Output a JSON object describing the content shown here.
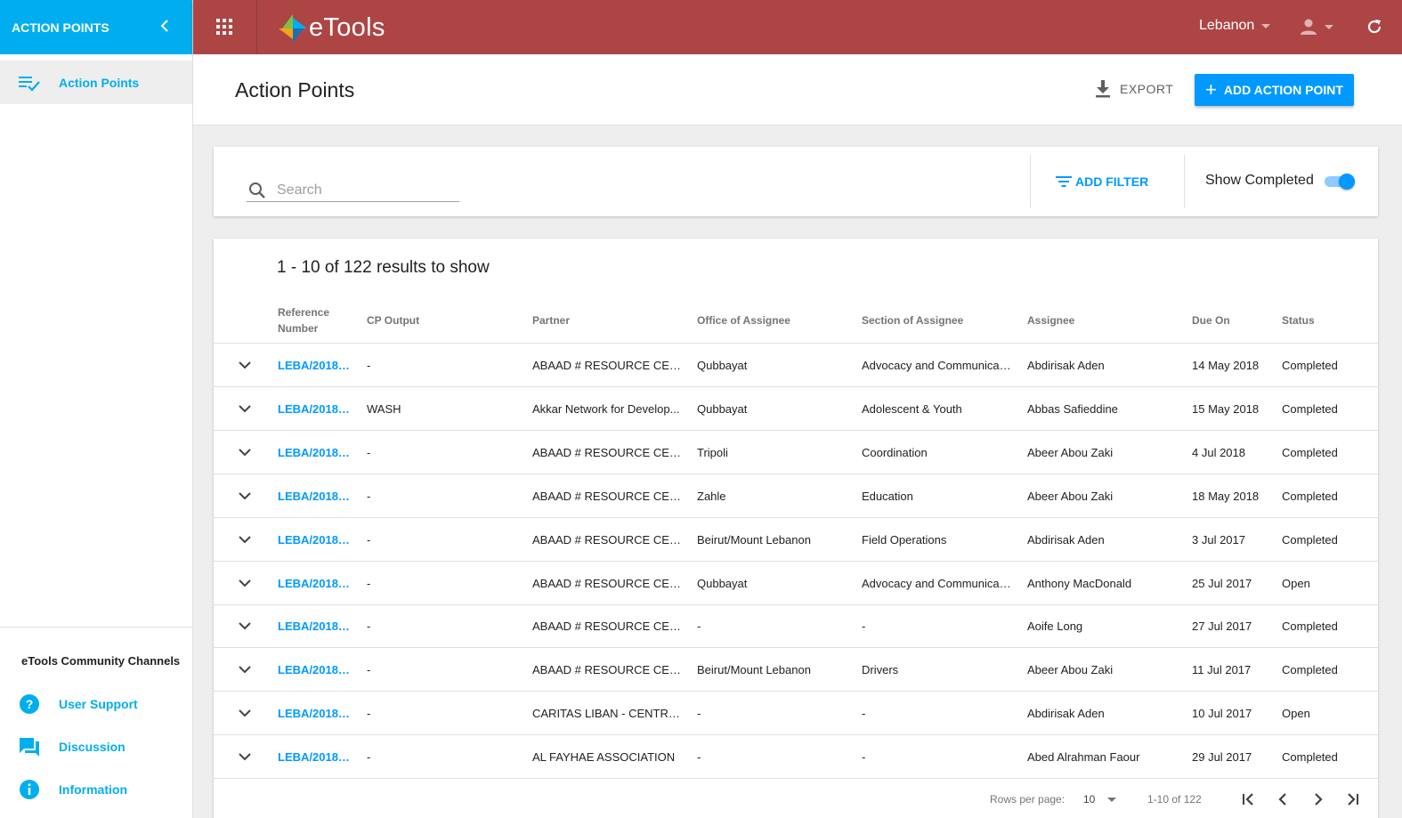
{
  "sidebar": {
    "header_title": "ACTION POINTS",
    "collapse_icon": "chevron-left-icon",
    "nav": [
      {
        "label": "Action Points",
        "icon": "checklist-icon"
      }
    ],
    "channels_title": "eTools Community Channels",
    "channels": [
      {
        "label": "User Support",
        "icon": "help-icon"
      },
      {
        "label": "Discussion",
        "icon": "forum-icon"
      },
      {
        "label": "Information",
        "icon": "info-icon"
      }
    ]
  },
  "topbar": {
    "logo_text": "eTools",
    "country": "Lebanon",
    "accent_color": "#ad4545"
  },
  "header": {
    "title": "Action Points",
    "export_label": "EXPORT",
    "add_label": "ADD ACTION POINT"
  },
  "filters": {
    "search_placeholder": "Search",
    "add_filter_label": "ADD FILTER",
    "show_completed_label": "Show Completed",
    "show_completed": true
  },
  "table": {
    "results_text": "1 - 10 of 122 results to show",
    "columns": [
      "Reference Number",
      "CP Output",
      "Partner",
      "Office of Assignee",
      "Section of Assignee",
      "Assignee",
      "Due On",
      "Status"
    ],
    "rows": [
      {
        "ref": "LEBA/2018/...",
        "cp_output": "-",
        "partner": "ABAAD # RESOURCE CENT...",
        "office": "Qubbayat",
        "section": "Advocacy and Communicat...",
        "assignee": "Abdirisak Aden",
        "due": "14 May 2018",
        "status": "Completed"
      },
      {
        "ref": "LEBA/2018/...",
        "cp_output": "WASH",
        "partner": "Akkar Network for Develop...",
        "office": "Qubbayat",
        "section": "Adolescent & Youth",
        "assignee": "Abbas Safieddine",
        "due": "15 May 2018",
        "status": "Completed"
      },
      {
        "ref": "LEBA/2018/...",
        "cp_output": "-",
        "partner": "ABAAD # RESOURCE CENT...",
        "office": "Tripoli",
        "section": "Coordination",
        "assignee": "Abeer Abou Zaki",
        "due": "4 Jul 2018",
        "status": "Completed"
      },
      {
        "ref": "LEBA/2018/...",
        "cp_output": "-",
        "partner": "ABAAD # RESOURCE CENT...",
        "office": "Zahle",
        "section": "Education",
        "assignee": "Abeer Abou Zaki",
        "due": "18 May 2018",
        "status": "Completed"
      },
      {
        "ref": "LEBA/2018/...",
        "cp_output": "-",
        "partner": "ABAAD # RESOURCE CENT...",
        "office": "Beirut/Mount Lebanon",
        "section": "Field Operations",
        "assignee": "Abdirisak Aden",
        "due": "3 Jul 2017",
        "status": "Completed"
      },
      {
        "ref": "LEBA/2018/...",
        "cp_output": "-",
        "partner": "ABAAD # RESOURCE CENT...",
        "office": "Qubbayat",
        "section": "Advocacy and Communicat...",
        "assignee": "Anthony MacDonald",
        "due": "25 Jul 2017",
        "status": "Open"
      },
      {
        "ref": "LEBA/2018/...",
        "cp_output": "-",
        "partner": "ABAAD # RESOURCE CENT...",
        "office": "-",
        "section": "-",
        "assignee": "Aoife Long",
        "due": "27 Jul 2017",
        "status": "Completed"
      },
      {
        "ref": "LEBA/2018/...",
        "cp_output": "-",
        "partner": "ABAAD # RESOURCE CENT...",
        "office": "Beirut/Mount Lebanon",
        "section": "Drivers",
        "assignee": "Abeer Abou Zaki",
        "due": "11 Jul 2017",
        "status": "Completed"
      },
      {
        "ref": "LEBA/2018/...",
        "cp_output": "-",
        "partner": "CARITAS LIBAN - CENTRE D...",
        "office": "-",
        "section": "-",
        "assignee": "Abdirisak Aden",
        "due": "10 Jul 2017",
        "status": "Open"
      },
      {
        "ref": "LEBA/2018/...",
        "cp_output": "-",
        "partner": "AL FAYHAE ASSOCIATION",
        "office": "-",
        "section": "-",
        "assignee": "Abed Alrahman Faour",
        "due": "29 Jul 2017",
        "status": "Completed"
      }
    ]
  },
  "pagination": {
    "rows_per_page_label": "Rows per page:",
    "rows_per_page": "10",
    "range_text": "1-10 of 122"
  }
}
